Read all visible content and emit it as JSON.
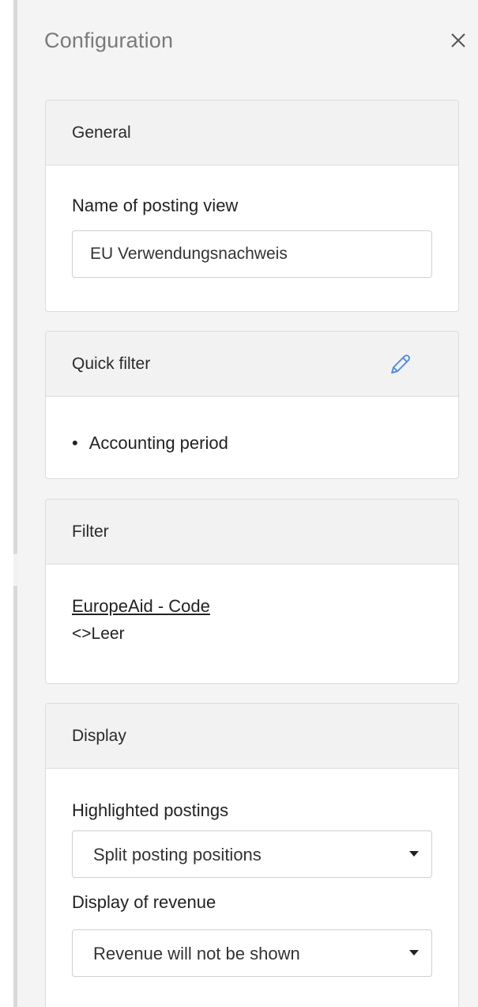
{
  "panel": {
    "title": "Configuration"
  },
  "general": {
    "heading": "General",
    "name_label": "Name of posting view",
    "name_value": "EU Verwendungsnachweis"
  },
  "quick_filter": {
    "heading": "Quick filter",
    "items": [
      "Accounting period"
    ]
  },
  "filter": {
    "heading": "Filter",
    "field": "EuropeAid - Code",
    "condition": "<>Leer"
  },
  "display": {
    "heading": "Display",
    "highlighted_label": "Highlighted postings",
    "highlighted_value": "Split posting positions",
    "revenue_label": "Display of revenue",
    "revenue_value": "Revenue will not be shown"
  },
  "icons": {
    "close": "close-icon",
    "edit": "pencil-icon",
    "dropdown": "caret-down-icon"
  },
  "colors": {
    "accent": "#4a86e8",
    "panel_bg": "#f4f4f4",
    "card_head_bg": "#f2f2f2",
    "border": "#dcdcdc"
  }
}
